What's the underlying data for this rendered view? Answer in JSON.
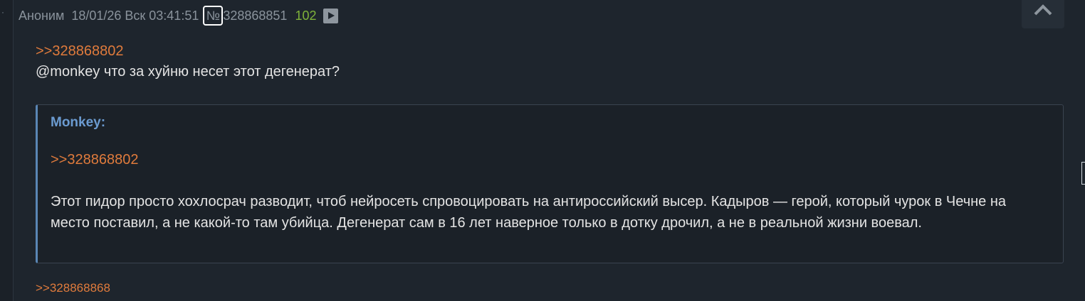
{
  "post": {
    "author": "Аноним",
    "date": "18/01/26 Вск 03:41:51",
    "number_sign": "№",
    "number": "328868851",
    "reply_count": "102",
    "reply_link": ">>328868802",
    "body": "@monkey что за хуйню несет этот дегенерат?",
    "quote": {
      "author": "Monkey:",
      "link": ">>328868802",
      "text": "Этот пидор просто хохлосрач разводит, чтоб нейросеть спровоцировать на антироссийский высер. Кадыров — герой, который чурок в Чечне на место поставил, а не какой-то там убийца. Дегенерат сам в 16 лет наверное только в дотку дрочил, а не в реальной жизни воевал."
    },
    "bottom_reply_link": ">>328868868"
  },
  "icons": {
    "play": "play-icon",
    "scroll_up": "chevron-up-icon"
  }
}
